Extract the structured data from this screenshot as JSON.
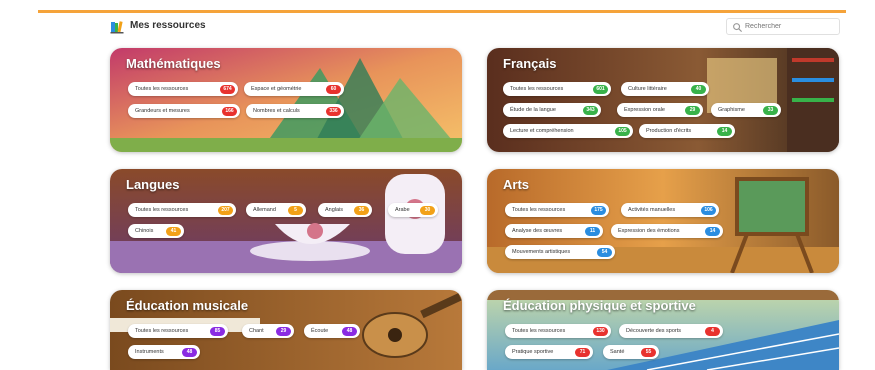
{
  "colors": {
    "accent_bar": "#f5a33a",
    "red": "#e8322e",
    "green": "#38b24a",
    "orange": "#f2a118",
    "blue": "#2a8de0",
    "purple": "#8a2be2"
  },
  "header": {
    "title": "Mes ressources",
    "logo_icon": "books-icon",
    "search_placeholder": "Rechercher",
    "search_icon": "search-icon"
  },
  "cards": [
    {
      "title": "Mathématiques",
      "badge_color": "red",
      "pills": [
        {
          "label": "Toutes les ressources",
          "count": "674"
        },
        {
          "label": "Espace et géométrie",
          "count": "60"
        },
        {
          "label": "Grandeurs et mesures",
          "count": "166"
        },
        {
          "label": "Nombres et calculs",
          "count": "336"
        }
      ]
    },
    {
      "title": "Français",
      "badge_color": "green",
      "pills": [
        {
          "label": "Toutes les ressources",
          "count": "601"
        },
        {
          "label": "Culture littéraire",
          "count": "40"
        },
        {
          "label": "Étude de la langue",
          "count": "343"
        },
        {
          "label": "Expression orale",
          "count": "29"
        },
        {
          "label": "Graphisme",
          "count": "33"
        },
        {
          "label": "Lecture et compréhension",
          "count": "105"
        },
        {
          "label": "Production d'écrits",
          "count": "14"
        }
      ]
    },
    {
      "title": "Langues",
      "badge_color": "orange",
      "pills": [
        {
          "label": "Toutes les ressources",
          "count": "207"
        },
        {
          "label": "Allemand",
          "count": "5"
        },
        {
          "label": "Anglais",
          "count": "36"
        },
        {
          "label": "Arabe",
          "count": "30"
        },
        {
          "label": "Chinois",
          "count": "41"
        }
      ]
    },
    {
      "title": "Arts",
      "badge_color": "blue",
      "pills": [
        {
          "label": "Toutes les ressources",
          "count": "175"
        },
        {
          "label": "Activités manuelles",
          "count": "106"
        },
        {
          "label": "Analyse des œuvres",
          "count": "11"
        },
        {
          "label": "Expression des émotions",
          "count": "14"
        },
        {
          "label": "Mouvements artistiques",
          "count": "54"
        }
      ]
    },
    {
      "title": "Éducation musicale",
      "badge_color": "purple",
      "pills": [
        {
          "label": "Toutes les ressources",
          "count": "85"
        },
        {
          "label": "Chant",
          "count": "29"
        },
        {
          "label": "Écoute",
          "count": "48"
        },
        {
          "label": "Instruments",
          "count": "48"
        }
      ]
    },
    {
      "title": "Éducation physique et sportive",
      "badge_color": "red",
      "pills": [
        {
          "label": "Toutes les ressources",
          "count": "130"
        },
        {
          "label": "Découverte des sports",
          "count": "4"
        },
        {
          "label": "Pratique sportive",
          "count": "71"
        },
        {
          "label": "Santé",
          "count": "55"
        }
      ]
    }
  ]
}
